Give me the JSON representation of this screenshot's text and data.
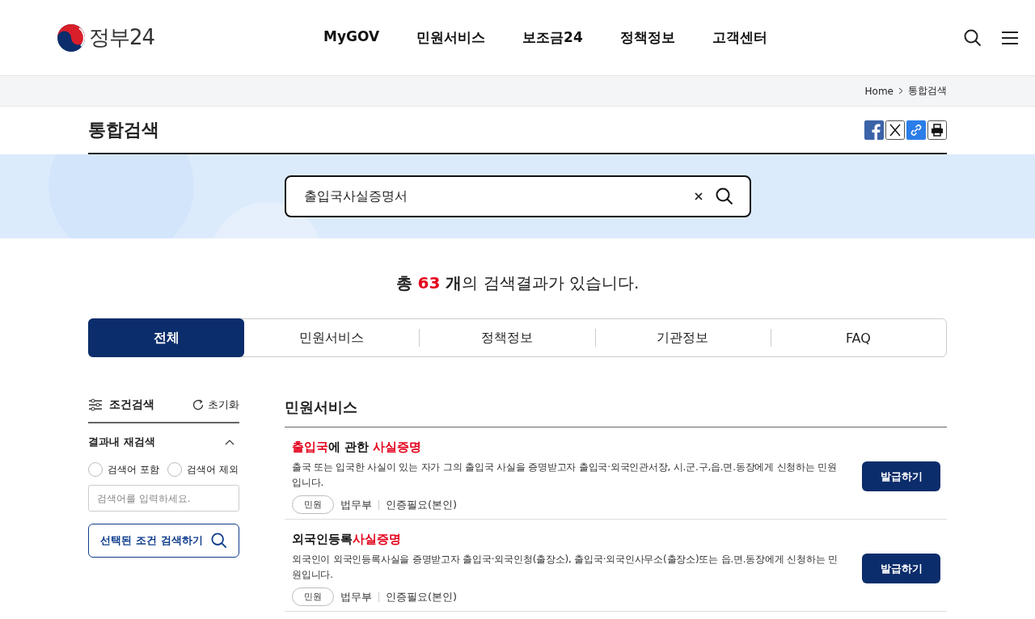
{
  "header": {
    "logo": "정부24",
    "nav": [
      "MyGOV",
      "민원서비스",
      "보조금24",
      "정책정보",
      "고객센터"
    ]
  },
  "breadcrumb": [
    "Home",
    "통합검색"
  ],
  "page_title": "통합검색",
  "search": {
    "value": "출입국사실증명서"
  },
  "result_summary": {
    "prefix": "총 ",
    "count": "63",
    "unit": " 개",
    "suffix": "의 검색결과가 있습니다."
  },
  "tabs": [
    {
      "label": "전체",
      "selected": true
    },
    {
      "label": "민원서비스",
      "selected": false
    },
    {
      "label": "정책정보",
      "selected": false
    },
    {
      "label": "기관정보",
      "selected": false
    },
    {
      "label": "FAQ",
      "selected": false
    }
  ],
  "filter": {
    "title": "조건검색",
    "reset": "초기화",
    "section": "결과내 재검색",
    "expanded": true,
    "options": [
      {
        "label": "검색어 포함",
        "selected": false
      },
      {
        "label": "검색어 제외",
        "selected": false
      }
    ],
    "placeholder": "검색어를 입력하세요.",
    "submit": "선택된 조건 검색하기"
  },
  "section_title": "민원서비스",
  "results": [
    {
      "title": [
        {
          "text": "출입국",
          "highlight": true
        },
        {
          "text": "에 관한 ",
          "highlight": false
        },
        {
          "text": "사실증명",
          "highlight": true
        }
      ],
      "description": "출국 또는 입국한 사실이 있는 자가 그의 출입국 사실을 증명받고자 출입국·외국인관서장, 시.군.구,읍.면.동장에게 신청하는 민원입니다.",
      "tag": "민원",
      "agency": "법무부",
      "auth": "인증필요(본인)",
      "button": "발급하기"
    },
    {
      "title": [
        {
          "text": "외국인등록",
          "highlight": false
        },
        {
          "text": "사실증명",
          "highlight": true
        }
      ],
      "description": "외국인이 외국인등록사실을 증명받고자 출입국·외국인청(출장소), 출입국·외국인사무소(출장소)또는 읍.면.동장에게 신청하는 민원입니다.",
      "tag": "민원",
      "agency": "법무부",
      "auth": "인증필요(본인)",
      "button": "발급하기"
    }
  ]
}
